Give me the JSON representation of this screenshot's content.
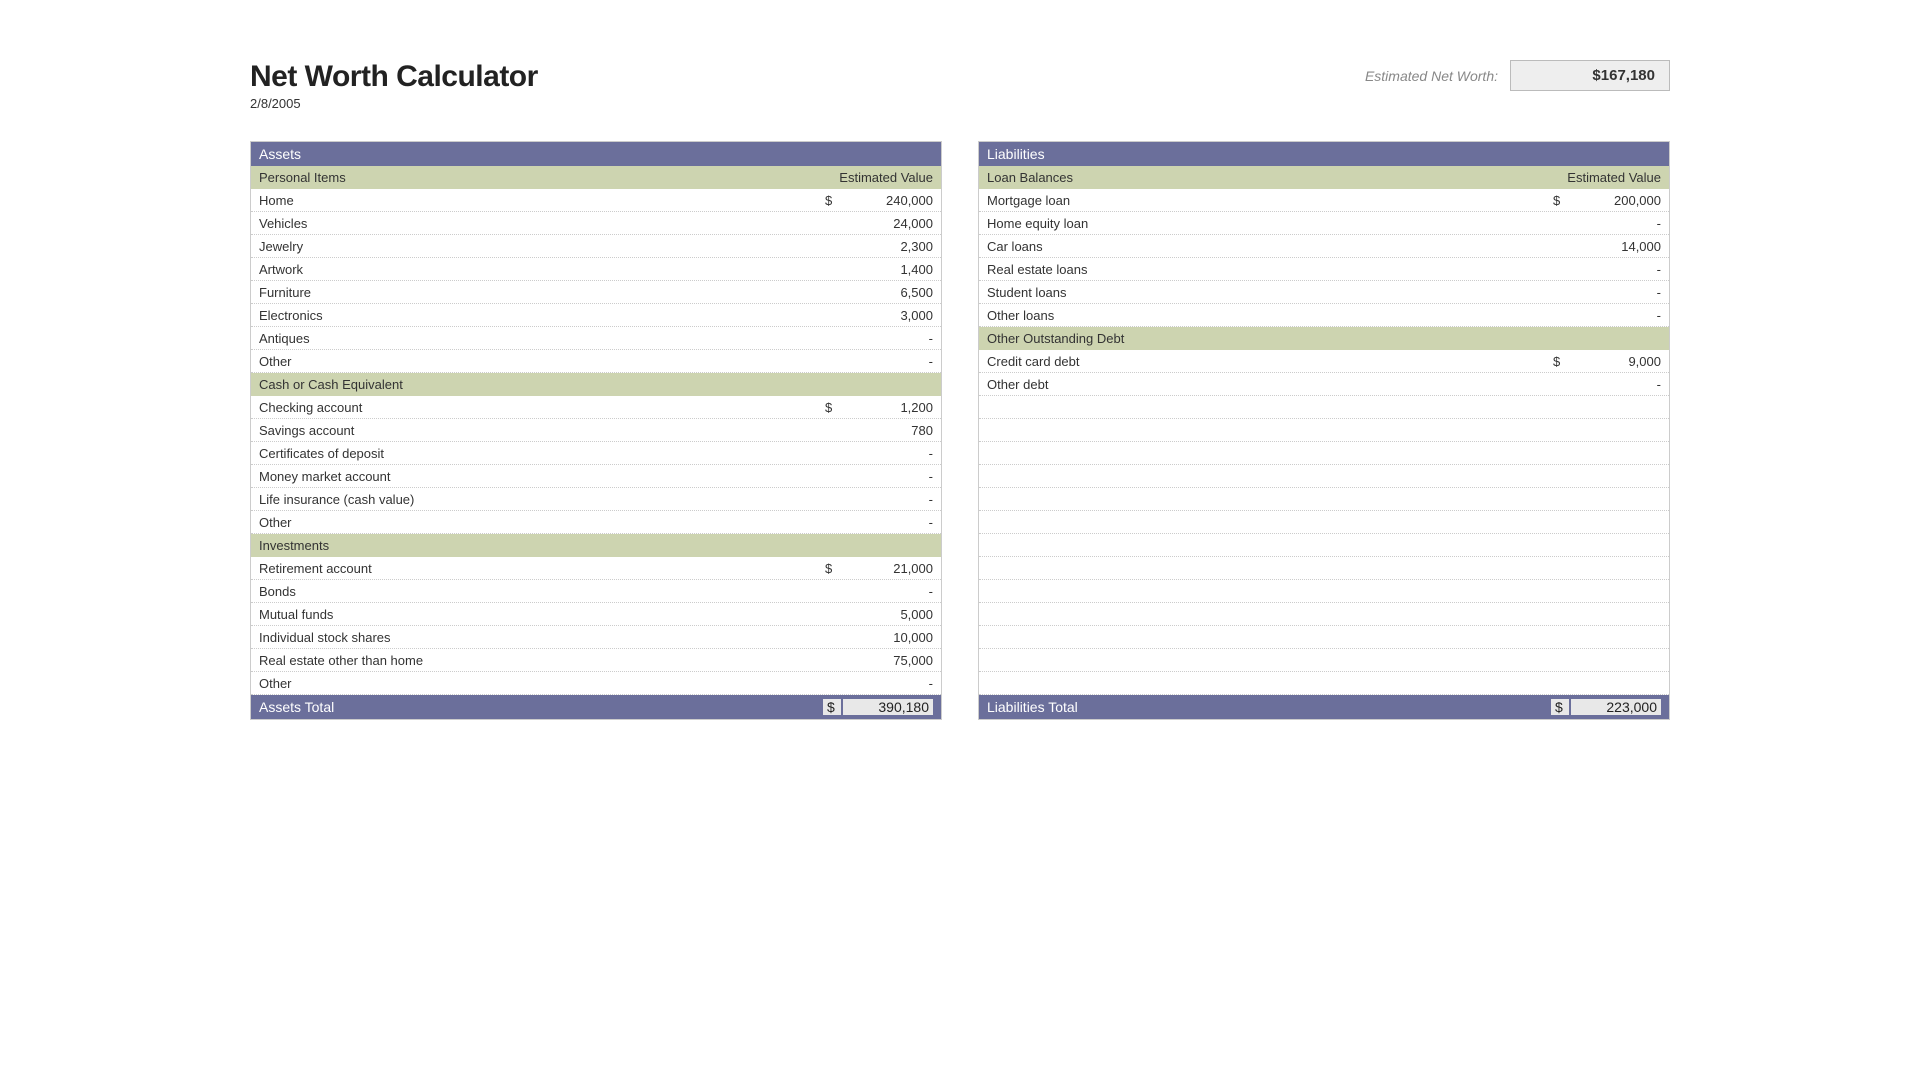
{
  "title": "Net Worth Calculator",
  "date": "2/8/2005",
  "networth_label": "Estimated Net Worth:",
  "networth_value": "$167,180",
  "assets": {
    "header": "Assets",
    "total_label": "Assets Total",
    "total_sym": "$",
    "total_value": "390,180",
    "groups": [
      {
        "title": "Personal Items",
        "value_label": "Estimated Value",
        "rows": [
          {
            "label": "Home",
            "sym": "$",
            "val": "240,000"
          },
          {
            "label": "Vehicles",
            "sym": "",
            "val": "24,000"
          },
          {
            "label": "Jewelry",
            "sym": "",
            "val": "2,300"
          },
          {
            "label": "Artwork",
            "sym": "",
            "val": "1,400"
          },
          {
            "label": "Furniture",
            "sym": "",
            "val": "6,500"
          },
          {
            "label": "Electronics",
            "sym": "",
            "val": "3,000"
          },
          {
            "label": "Antiques",
            "sym": "",
            "val": "-"
          },
          {
            "label": "Other",
            "sym": "",
            "val": "-"
          }
        ]
      },
      {
        "title": "Cash or Cash Equivalent",
        "value_label": "",
        "rows": [
          {
            "label": "Checking account",
            "sym": "$",
            "val": "1,200"
          },
          {
            "label": "Savings account",
            "sym": "",
            "val": "780"
          },
          {
            "label": "Certificates of deposit",
            "sym": "",
            "val": "-"
          },
          {
            "label": "Money market account",
            "sym": "",
            "val": "-"
          },
          {
            "label": "Life insurance (cash value)",
            "sym": "",
            "val": "-"
          },
          {
            "label": "Other",
            "sym": "",
            "val": "-"
          }
        ]
      },
      {
        "title": "Investments",
        "value_label": "",
        "rows": [
          {
            "label": "Retirement account",
            "sym": "$",
            "val": "21,000"
          },
          {
            "label": "Bonds",
            "sym": "",
            "val": "-"
          },
          {
            "label": "Mutual funds",
            "sym": "",
            "val": "5,000"
          },
          {
            "label": "Individual stock shares",
            "sym": "",
            "val": "10,000"
          },
          {
            "label": "Real estate other than home",
            "sym": "",
            "val": "75,000"
          },
          {
            "label": "Other",
            "sym": "",
            "val": "-"
          }
        ]
      }
    ]
  },
  "liabilities": {
    "header": "Liabilities",
    "total_label": "Liabilities Total",
    "total_sym": "$",
    "total_value": "223,000",
    "empty_rows": 13,
    "groups": [
      {
        "title": "Loan Balances",
        "value_label": "Estimated Value",
        "rows": [
          {
            "label": "Mortgage loan",
            "sym": "$",
            "val": "200,000"
          },
          {
            "label": "Home equity loan",
            "sym": "",
            "val": "-"
          },
          {
            "label": "Car loans",
            "sym": "",
            "val": "14,000"
          },
          {
            "label": "Real estate loans",
            "sym": "",
            "val": "-"
          },
          {
            "label": "Student loans",
            "sym": "",
            "val": "-"
          },
          {
            "label": "Other loans",
            "sym": "",
            "val": "-"
          }
        ]
      },
      {
        "title": "Other Outstanding Debt",
        "value_label": "",
        "rows": [
          {
            "label": "Credit card debt",
            "sym": "$",
            "val": "9,000"
          },
          {
            "label": "Other debt",
            "sym": "",
            "val": "-"
          }
        ]
      }
    ]
  }
}
